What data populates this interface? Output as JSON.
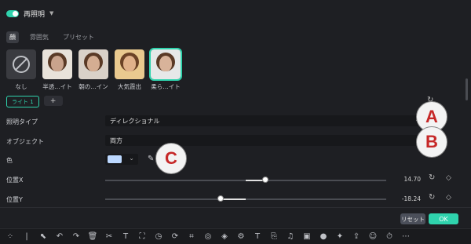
{
  "header": {
    "title": "再照明"
  },
  "tabs": [
    "顔",
    "雰囲気",
    "プリセット"
  ],
  "presets": [
    {
      "label": "なし"
    },
    {
      "label": "半透…イト"
    },
    {
      "label": "朝の…イン"
    },
    {
      "label": "大気霞出"
    },
    {
      "label": "柔ら…イト"
    }
  ],
  "lights": {
    "light1": "ライト 1",
    "add": "+"
  },
  "lighting_type": {
    "label": "照明タイプ",
    "value": "ディレクショナル"
  },
  "object": {
    "label": "オブジェクト",
    "value": "両方"
  },
  "color": {
    "label": "色",
    "swatch": "#bcd8ff"
  },
  "position_x": {
    "label": "位置X",
    "value": "14.70",
    "fraction": 0.57
  },
  "position_y": {
    "label": "位置Y",
    "value": "-18.24",
    "fraction": 0.41
  },
  "annotations": {
    "a": "A",
    "b": "B",
    "c": "C"
  },
  "footer": {
    "reset": "リセット",
    "ok": "OK"
  },
  "colors": {
    "accent": "#2fd3ad",
    "marker": "#c62828"
  }
}
